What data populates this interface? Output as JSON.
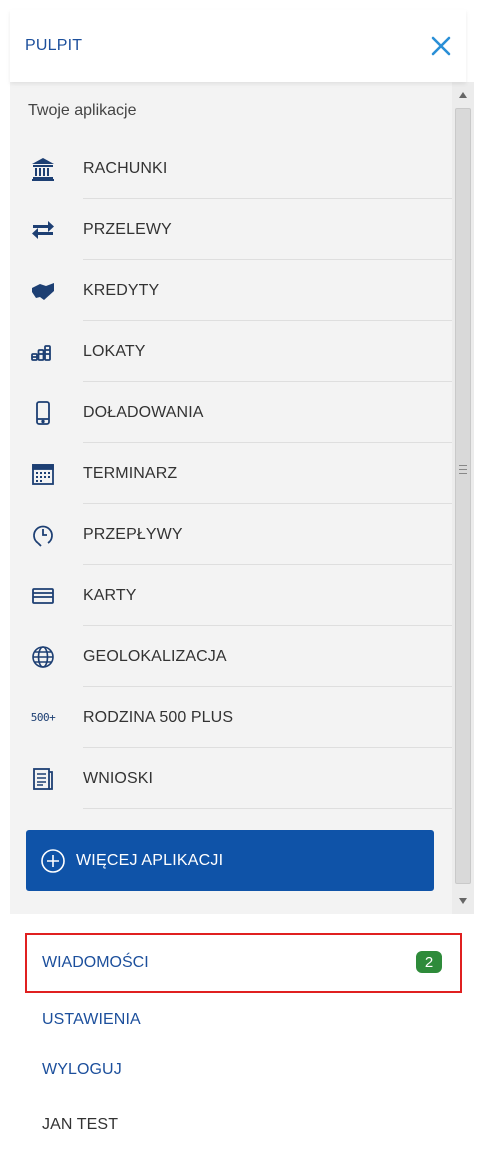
{
  "header": {
    "title": "PULPIT",
    "close_icon": "close-icon"
  },
  "apps": {
    "heading": "Twoje aplikacje",
    "items": [
      {
        "label": "RACHUNKI",
        "icon": "bank-icon"
      },
      {
        "label": "PRZELEWY",
        "icon": "transfer-arrows-icon"
      },
      {
        "label": "KREDYTY",
        "icon": "credit-handshake-icon"
      },
      {
        "label": "LOKATY",
        "icon": "coin-stacks-icon"
      },
      {
        "label": "DOŁADOWANIA",
        "icon": "mobile-phone-icon"
      },
      {
        "label": "TERMINARZ",
        "icon": "calendar-icon"
      },
      {
        "label": "PRZEPŁYWY",
        "icon": "clock-flow-icon"
      },
      {
        "label": "KARTY",
        "icon": "card-icon"
      },
      {
        "label": "GEOLOKALIZACJA",
        "icon": "globe-icon"
      },
      {
        "label": "RODZINA 500 PLUS",
        "icon": "500-plus-icon"
      },
      {
        "label": "WNIOSKI",
        "icon": "document-icon"
      }
    ],
    "more_button": "WIĘCEJ APLIKACJI",
    "icon_500": "500+"
  },
  "bottom": {
    "messages": "WIADOMOŚCI",
    "messages_count": "2",
    "settings": "USTAWIENIA",
    "logout": "WYLOGUJ",
    "user": "JAN TEST"
  },
  "colors": {
    "accent": "#1c4f9c",
    "button": "#0f53a8",
    "badge": "#2e8b3a",
    "highlight": "#e02020"
  }
}
